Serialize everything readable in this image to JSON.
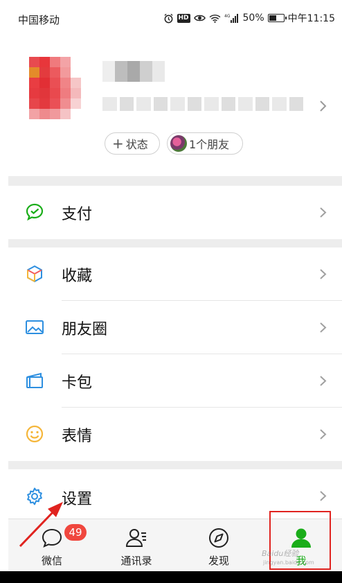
{
  "status_bar": {
    "carrier": "中国移动",
    "network": "4G",
    "battery": "50%",
    "battery_level": 0.5,
    "time": "中午11:15",
    "icons": [
      "alarm-icon",
      "hd-icon",
      "eye-icon",
      "wifi-icon",
      "signal-icon",
      "battery-icon"
    ]
  },
  "profile": {
    "chips": {
      "status": "状态",
      "friends": "1个朋友"
    }
  },
  "menu": {
    "pay": {
      "label": "支付",
      "icon": "pay-icon"
    },
    "favorites": {
      "label": "收藏",
      "icon": "favorites-cube-icon"
    },
    "moments": {
      "label": "朋友圈",
      "icon": "moments-picture-icon"
    },
    "cards": {
      "label": "卡包",
      "icon": "card-wallet-icon"
    },
    "stickers": {
      "label": "表情",
      "icon": "smiley-icon"
    },
    "settings": {
      "label": "设置",
      "icon": "gear-icon"
    }
  },
  "tabbar": {
    "tabs": [
      {
        "label": "微信",
        "icon": "chat-bubble-icon",
        "badge": "49"
      },
      {
        "label": "通讯录",
        "icon": "contacts-icon"
      },
      {
        "label": "发现",
        "icon": "compass-icon"
      },
      {
        "label": "我",
        "icon": "person-icon",
        "active": true
      }
    ]
  },
  "watermark": {
    "line1": "Baidu经验",
    "line2": "jingyan.baidu.com"
  },
  "colors": {
    "accent_green": "#1aad19",
    "badge_red": "#f0473e",
    "highlight_red": "#e0231f",
    "separator_gray": "#ededed"
  }
}
